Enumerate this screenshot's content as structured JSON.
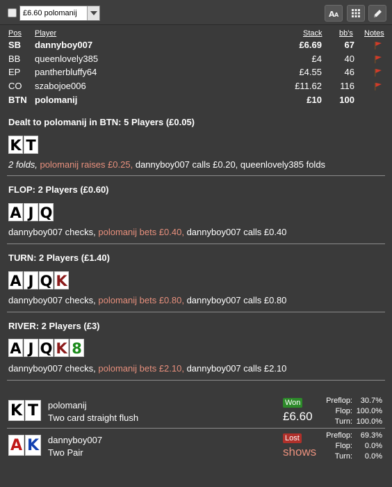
{
  "toolbar": {
    "hand_selector_value": "£6.60 polomanij"
  },
  "table_headers": {
    "pos": "Pos",
    "player": "Player",
    "stack": "Stack",
    "bbs": "bb's",
    "notes": "Notes"
  },
  "players": [
    {
      "pos": "SB",
      "name": "dannyboy007",
      "stack": "£6.69",
      "bbs": "67"
    },
    {
      "pos": "BB",
      "name": "queenlovely385",
      "stack": "£4",
      "bbs": "40"
    },
    {
      "pos": "EP",
      "name": "pantherbluffy64",
      "stack": "£4.55",
      "bbs": "46"
    },
    {
      "pos": "CO",
      "name": "szabojoe006",
      "stack": "£11.62",
      "bbs": "116"
    },
    {
      "pos": "BTN",
      "name": "polomanij",
      "stack": "£10",
      "bbs": "100"
    }
  ],
  "preflop": {
    "title": "Dealt to polomanij in BTN: 5 Players (£0.05)",
    "cards": [
      "K",
      "T"
    ],
    "actions": {
      "a1": "2 folds, ",
      "a2": "polomanij raises £0.25, ",
      "a3": "dannyboy007 calls £0.20, queenlovely385 folds"
    }
  },
  "flop": {
    "title": "FLOP: 2 Players (£0.60)",
    "cards": [
      "A",
      "J",
      "Q"
    ],
    "actions": {
      "a1": "dannyboy007 checks, ",
      "a2": "polomanij bets £0.40, ",
      "a3": "dannyboy007 calls £0.40"
    }
  },
  "turn": {
    "title": "TURN: 2 Players (£1.40)",
    "cards": [
      "A",
      "J",
      "Q",
      "K"
    ],
    "actions": {
      "a1": "dannyboy007 checks, ",
      "a2": "polomanij bets £0.80, ",
      "a3": "dannyboy007 calls £0.80"
    }
  },
  "river": {
    "title": "RIVER: 2 Players (£3)",
    "cards": [
      "A",
      "J",
      "Q",
      "K",
      "8"
    ],
    "actions": {
      "a1": "dannyboy007 checks, ",
      "a2": "polomanij bets £2.10, ",
      "a3": "dannyboy007 calls £2.10"
    }
  },
  "results": [
    {
      "cards": [
        "K",
        "T"
      ],
      "name": "polomanij",
      "hand": "Two card straight flush",
      "badge": "Won",
      "amount": "£6.60",
      "equity": {
        "preflop_label": "Preflop:",
        "preflop": "30.7%",
        "flop_label": "Flop:",
        "flop": "100.0%",
        "turn_label": "Turn:",
        "turn": "100.0%"
      }
    },
    {
      "cards": [
        "A",
        "K"
      ],
      "name": "dannyboy007",
      "hand": "Two Pair",
      "badge": "Lost",
      "amount": "shows",
      "equity": {
        "preflop_label": "Preflop:",
        "preflop": "69.3%",
        "flop_label": "Flop:",
        "flop": "0.0%",
        "turn_label": "Turn:",
        "turn": "0.0%"
      }
    }
  ],
  "colors": {
    "background": "#3a3a3a",
    "hero_action": "#e8907d",
    "won_badge": "#2d8a2a",
    "lost_badge": "#b0302a",
    "note_flag": "#d23a2a"
  },
  "icons": [
    "checkbox",
    "chevron-down-icon",
    "font-size-icon",
    "grid-icon",
    "pencil-icon",
    "note-flag-icon"
  ]
}
